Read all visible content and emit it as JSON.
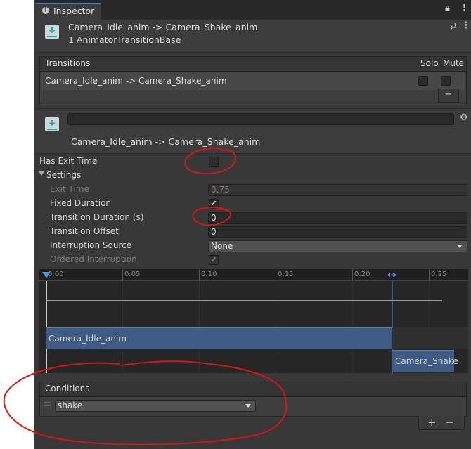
{
  "window": {
    "tab_title": "Inspector"
  },
  "header": {
    "title": "Camera_Idle_anim -> Camera_Shake_anim",
    "subtitle": "1 AnimatorTransitionBase"
  },
  "transitions": {
    "header_label": "Transitions",
    "solo_label": "Solo",
    "mute_label": "Mute",
    "rows": [
      {
        "name": "Camera_Idle_anim -> Camera_Shake_anim",
        "solo": false,
        "mute": false
      }
    ],
    "remove_label": "−"
  },
  "selected": {
    "name_value": "",
    "caption": "Camera_Idle_anim -> Camera_Shake_anim"
  },
  "properties": {
    "has_exit_time_label": "Has Exit Time",
    "has_exit_time": false,
    "settings_label": "Settings",
    "exit_time_label": "Exit Time",
    "exit_time_value": "0.75",
    "fixed_duration_label": "Fixed Duration",
    "fixed_duration": true,
    "transition_duration_label": "Transition Duration (s)",
    "transition_duration_value": "0",
    "transition_offset_label": "Transition Offset",
    "transition_offset_value": "0",
    "interruption_source_label": "Interruption Source",
    "interruption_source_value": "None",
    "ordered_interruption_label": "Ordered Interruption",
    "ordered_interruption": true
  },
  "timeline": {
    "ticks": [
      "0:00",
      "0:05",
      "0:10",
      "0:15",
      "0:20",
      "0:25"
    ],
    "from_clip": "Camera_Idle_anim",
    "to_clip": "Camera_Shake"
  },
  "conditions": {
    "header_label": "Conditions",
    "items": [
      {
        "parameter": "shake"
      }
    ],
    "add_label": "+",
    "remove_label": "−"
  },
  "colors": {
    "panel_bg": "#383838",
    "accent_blue": "#3a79bb",
    "clip_blue": "#3e5b85",
    "annotation_red": "#d01818"
  }
}
